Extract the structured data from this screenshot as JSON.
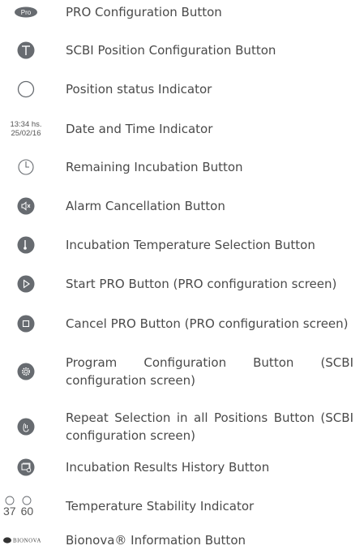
{
  "legend": [
    {
      "icon": "pro-icon",
      "icon_text": "Pro",
      "label": "PRO Configuration Button"
    },
    {
      "icon": "scbi-position-icon",
      "label": "SCBI Position Configuration Button"
    },
    {
      "icon": "position-status-icon",
      "label": "Position status Indicator"
    },
    {
      "icon": "datetime-icon",
      "time": "13:34 hs.",
      "date": "25/02/16",
      "label": "Date and Time Indicator"
    },
    {
      "icon": "clock-icon",
      "label": "Remaining Incubation Button"
    },
    {
      "icon": "mute-icon",
      "label": "Alarm Cancellation Button"
    },
    {
      "icon": "thermometer-icon",
      "label": "Incubation Temperature Selection Button"
    },
    {
      "icon": "play-icon",
      "label": "Start PRO Button (PRO configuration screen)"
    },
    {
      "icon": "stop-icon",
      "label": "Cancel PRO Button (PRO configuration screen)"
    },
    {
      "icon": "gear-icon",
      "label": "Program Configuration Button (SCBI configuration screen)"
    },
    {
      "icon": "hand-icon",
      "label": "Repeat Selection in all Positions Button (SCBI configuration screen)"
    },
    {
      "icon": "history-icon",
      "label": "Incubation Results History Button"
    },
    {
      "icon": "temperature-stability-icon",
      "temps": [
        "37",
        "60"
      ],
      "label": "Temperature Stability Indicator"
    },
    {
      "icon": "bionova-logo-icon",
      "logo_text": "BIONOVA",
      "label": "Bionova® Information Button"
    }
  ],
  "colors": {
    "button": "#676b70",
    "button_edge": "#52565b",
    "text": "#4a4a4a"
  }
}
